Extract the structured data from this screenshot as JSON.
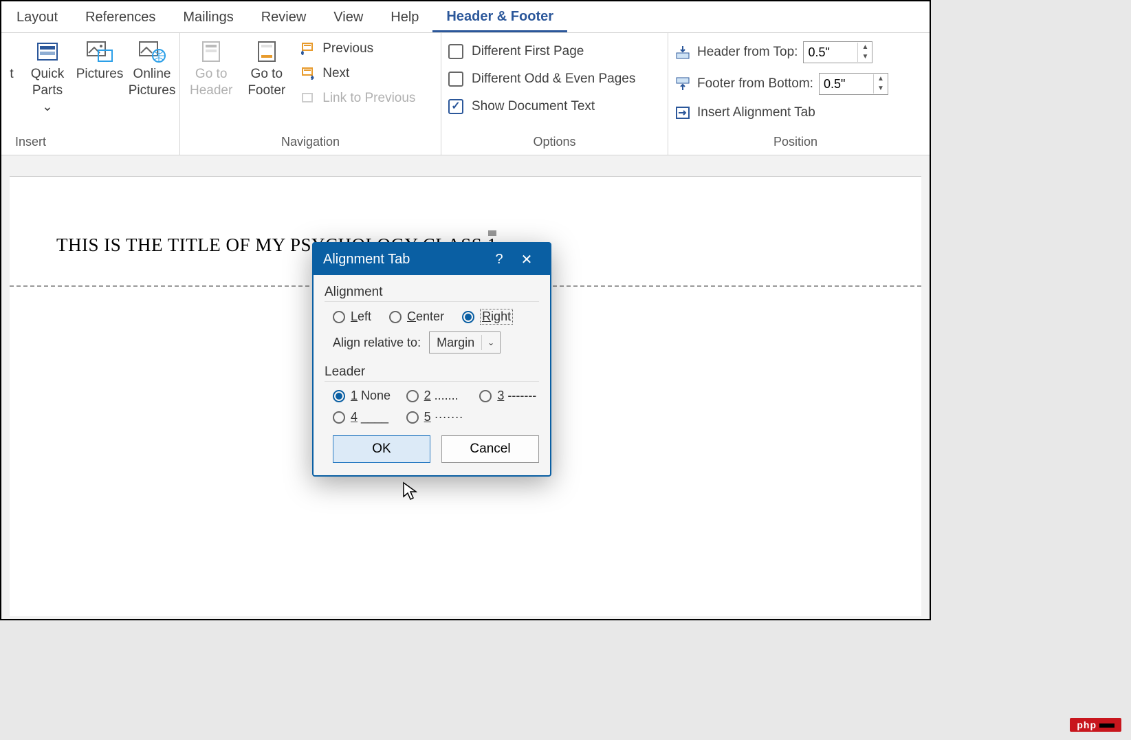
{
  "tabs": {
    "layout": "Layout",
    "references": "References",
    "mailings": "Mailings",
    "review": "Review",
    "view": "View",
    "help": "Help",
    "hf": "Header & Footer"
  },
  "ribbon": {
    "insert": {
      "label": "Insert",
      "truncated": "t",
      "quick": "Quick",
      "parts": "Parts ⌄",
      "pictures": "Pictures",
      "online": "Online",
      "pictures2": "Pictures"
    },
    "nav": {
      "label": "Navigation",
      "goHeader1": "Go to",
      "goHeader2": "Header",
      "goFooter1": "Go to",
      "goFooter2": "Footer",
      "prev": "Previous",
      "next": "Next",
      "link": "Link to Previous"
    },
    "options": {
      "label": "Options",
      "diffFirst": "Different First Page",
      "diffOdd": "Different Odd & Even Pages",
      "showDoc": "Show Document Text",
      "checked": {
        "diffFirst": false,
        "diffOdd": false,
        "showDoc": true
      }
    },
    "position": {
      "label": "Position",
      "hdrTop": "Header from Top:",
      "hdrVal": "0.5\"",
      "ftrBot": "Footer from Bottom:",
      "ftrVal": "0.5\"",
      "insertTab": "Insert Alignment Tab"
    }
  },
  "document": {
    "headerText": "THIS IS THE TITLE OF MY PSYCHOLOGY CLASS",
    "pageNum": "1"
  },
  "dialog": {
    "title": "Alignment Tab",
    "help": "?",
    "close": "✕",
    "alignment": {
      "title": "Alignment",
      "left": "Left",
      "center": "Center",
      "right": "Right",
      "selected": "right",
      "relLabel": "Align relative to:",
      "relValue": "Margin"
    },
    "leader": {
      "title": "Leader",
      "opt1": "1 None",
      "opt2": "2 .......",
      "opt3": "3 -------",
      "opt4": "4 ____",
      "opt5": "5 ·······",
      "selected": "1"
    },
    "buttons": {
      "ok": "OK",
      "cancel": "Cancel"
    }
  },
  "watermark": "php"
}
